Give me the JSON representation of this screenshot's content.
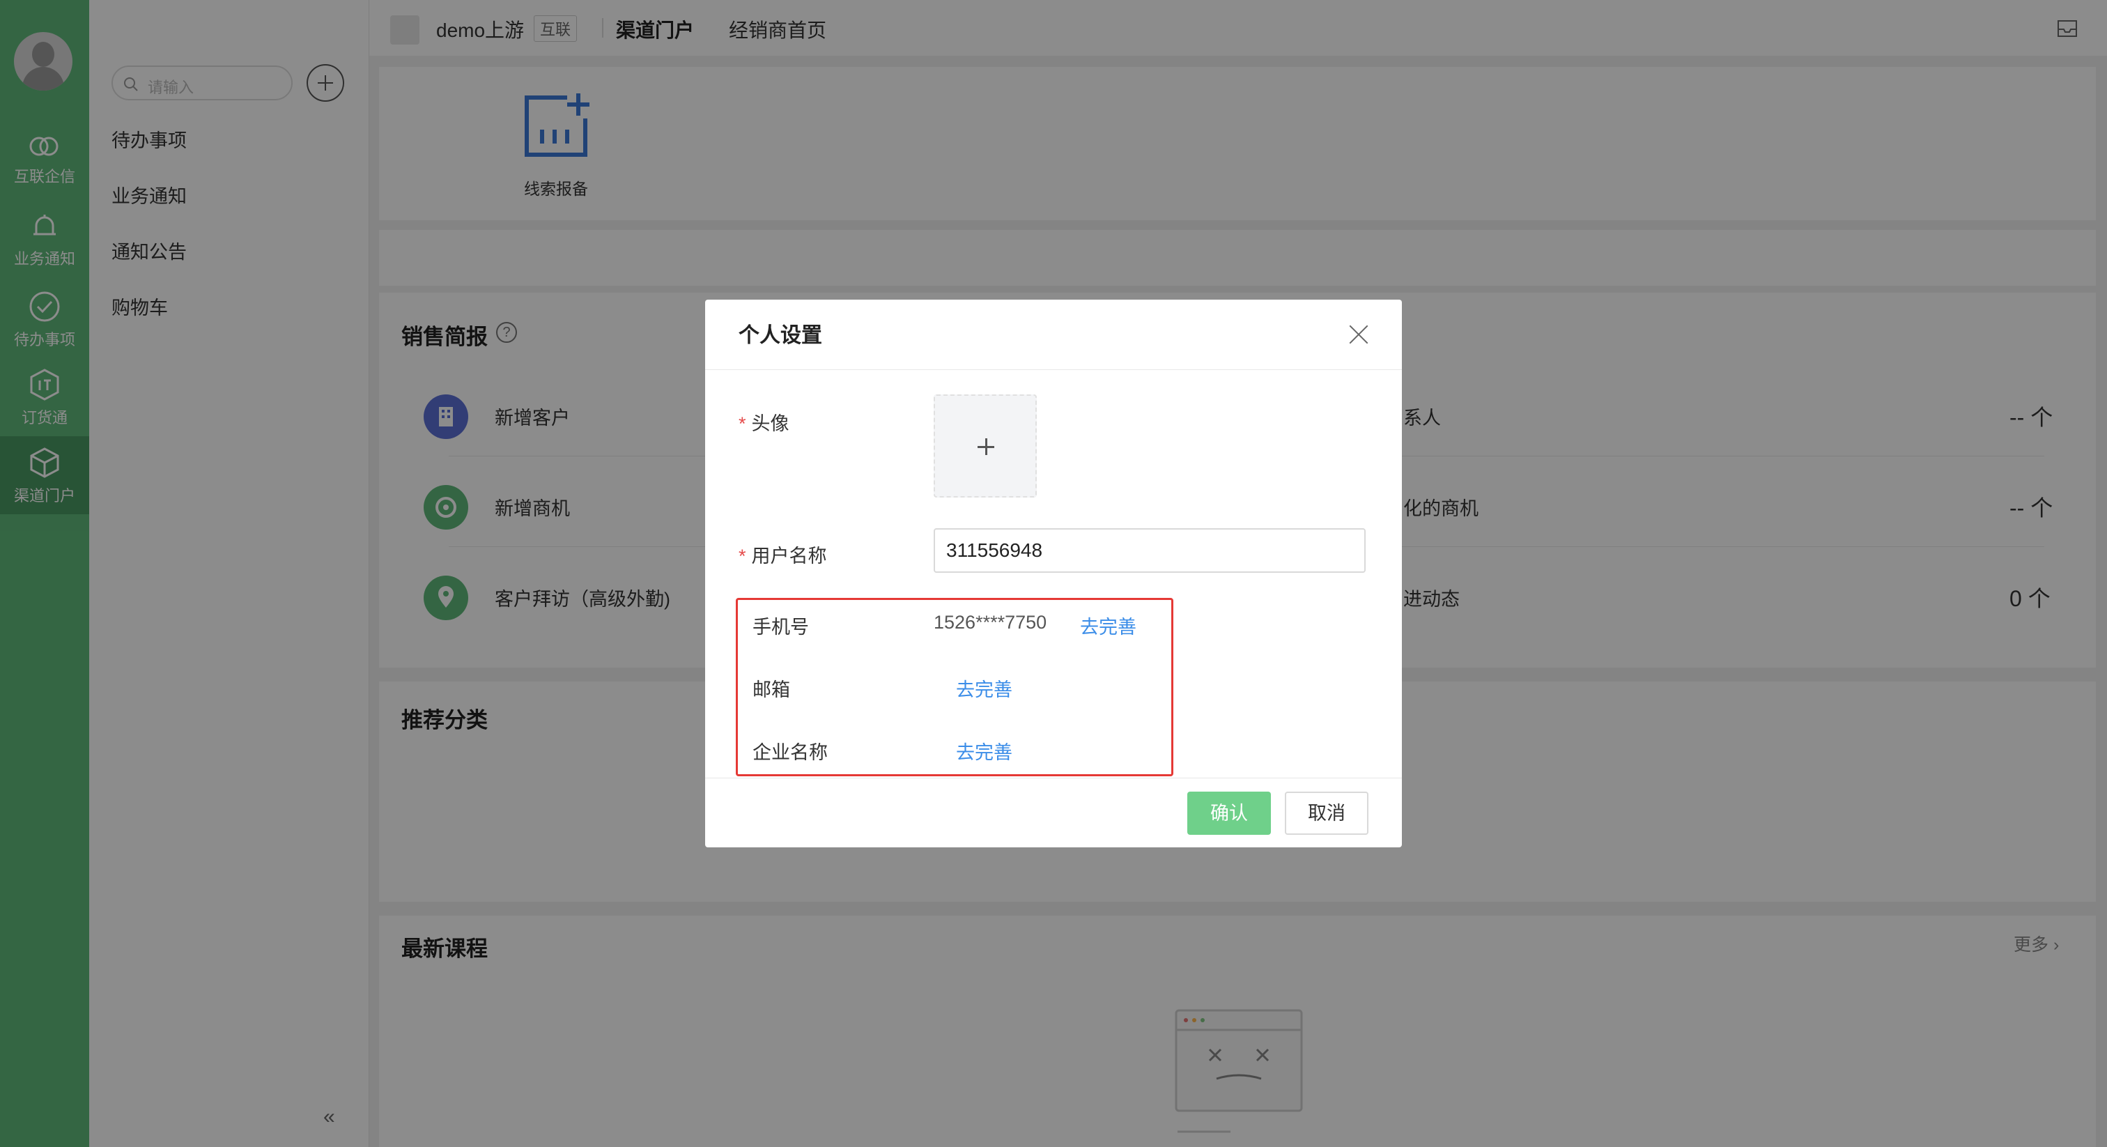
{
  "rail": {
    "items": [
      {
        "label": "互联企信",
        "icon": "link-rings-icon"
      },
      {
        "label": "业务通知",
        "icon": "bell-icon"
      },
      {
        "label": "待办事项",
        "icon": "check-circle-icon"
      },
      {
        "label": "订货通",
        "icon": "order-tag-icon"
      },
      {
        "label": "渠道门户",
        "icon": "cube-icon"
      }
    ]
  },
  "sidebar": {
    "search_placeholder": "请输入",
    "items": [
      {
        "label": "待办事项"
      },
      {
        "label": "业务通知"
      },
      {
        "label": "通知公告"
      },
      {
        "label": "购物车"
      }
    ],
    "collapse_label": "«"
  },
  "header": {
    "org_name": "demo上游",
    "org_tag": "互联",
    "tabs": [
      {
        "label": "渠道门户"
      },
      {
        "label": "经销商首页"
      }
    ]
  },
  "quick_actions": {
    "items": [
      {
        "label": "线索报备"
      }
    ]
  },
  "sales": {
    "title": "销售简报",
    "help": "?",
    "left": [
      {
        "label": "新增客户",
        "color": "#5b6fd6"
      },
      {
        "label": "新增商机",
        "color": "#5fb97a"
      },
      {
        "label": "客户拜访（高级外勤)",
        "color": "#5fb97a"
      }
    ],
    "right": [
      {
        "label": "系人",
        "value": "-- 个"
      },
      {
        "label": "化的商机",
        "value": "-- 个"
      },
      {
        "label": "进动态",
        "value": "0 个"
      }
    ]
  },
  "recommend": {
    "title": "推荐分类"
  },
  "courses": {
    "title": "最新课程",
    "more": "更多 ›"
  },
  "modal": {
    "title": "个人设置",
    "required_mark": "*",
    "avatar_label": "头像",
    "username_label": "用户名称",
    "username_value": "311556948",
    "phone_label": "手机号",
    "phone_value": "1526****7750",
    "phone_action": "去完善",
    "email_label": "邮箱",
    "email_action": "去完善",
    "company_label": "企业名称",
    "company_action": "去完善",
    "confirm_label": "确认",
    "cancel_label": "取消"
  }
}
